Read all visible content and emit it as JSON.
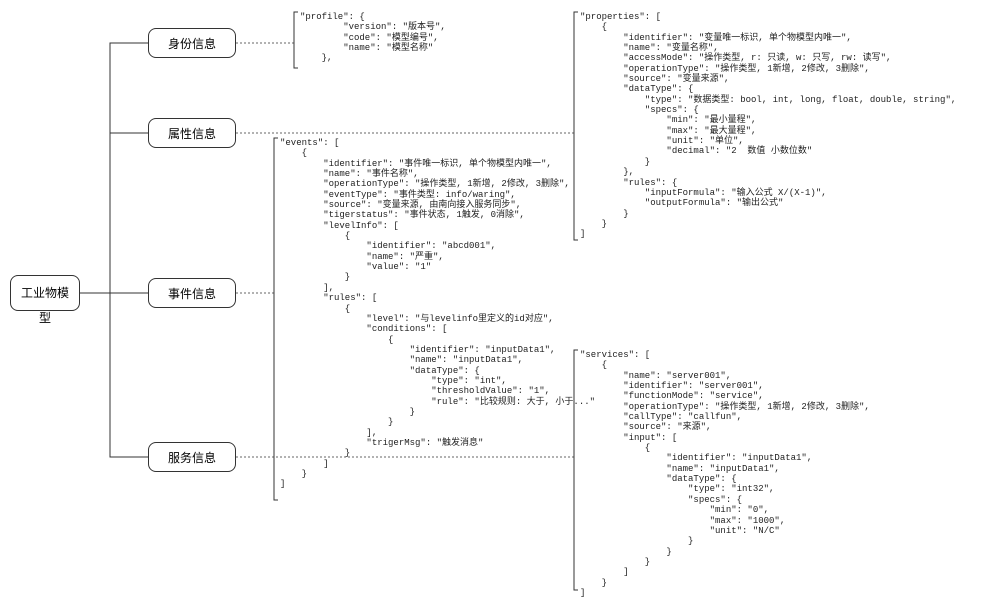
{
  "root": {
    "label": "工业物模型"
  },
  "children": [
    {
      "id": "identity",
      "label": "身份信息"
    },
    {
      "id": "property",
      "label": "属性信息"
    },
    {
      "id": "event",
      "label": "事件信息"
    },
    {
      "id": "service",
      "label": "服务信息"
    }
  ],
  "json_blocks": {
    "profile": "\"profile\": {\n        \"version\": \"版本号\",\n        \"code\": \"模型编号\",\n        \"name\": \"模型名称\"\n    },",
    "events": "\"events\": [\n    {\n        \"identifier\": \"事件唯一标识, 单个物模型内唯一\",\n        \"name\": \"事件名称\",\n        \"operationType\": \"操作类型, 1新增, 2修改, 3删除\",\n        \"eventType\": \"事件类型: info/waring\",\n        \"source\": \"变量来源, 由南向接入服务同步\",\n        \"tigerstatus\": \"事件状态, 1触发, 0消除\",\n        \"levelInfo\": [\n            {\n                \"identifier\": \"abcd001\",\n                \"name\": \"严重\",\n                \"value\": \"1\"\n            }\n        ],\n        \"rules\": [\n            {\n                \"level\": \"与levelinfo里定义的id对应\",\n                \"conditions\": [\n                    {\n                        \"identifier\": \"inputData1\",\n                        \"name\": \"inputData1\",\n                        \"dataType\": {\n                            \"type\": \"int\",\n                            \"thresholdValue\": \"1\",\n                            \"rule\": \"比较规则: 大于, 小于...\"\n                        }\n                    }\n                ],\n                \"trigerMsg\": \"触发消息\"\n            }\n        ]\n    }\n]",
    "properties": "\"properties\": [\n    {\n        \"identifier\": \"变量唯一标识, 单个物模型内唯一\",\n        \"name\": \"变量名称\",\n        \"accessMode\": \"操作类型, r: 只读, w: 只写, rw: 读写\",\n        \"operationType\": \"操作类型, 1新增, 2修改, 3删除\",\n        \"source\": \"变量来源\",\n        \"dataType\": {\n            \"type\": \"数据类型: bool, int, long, float, double, string\",\n            \"specs\": {\n                \"min\": \"最小量程\",\n                \"max\": \"最大量程\",\n                \"unit\": \"单位\",\n                \"decimal\": \"2  数值 小数位数\"\n            }\n        },\n        \"rules\": {\n            \"inputFormula\": \"输入公式 X/(X-1)\",\n            \"outputFormula\": \"输出公式\"\n        }\n    }\n]",
    "services": "\"services\": [\n    {\n        \"name\": \"server001\",\n        \"identifier\": \"server001\",\n        \"functionMode\": \"service\",\n        \"operationType\": \"操作类型, 1新增, 2修改, 3删除\",\n        \"callType\": \"callfun\",\n        \"source\": \"来源\",\n        \"input\": [\n            {\n                \"identifier\": \"inputData1\",\n                \"name\": \"inputData1\",\n                \"dataType\": {\n                    \"type\": \"int32\",\n                    \"specs\": {\n                        \"min\": \"0\",\n                        \"max\": \"1000\",\n                        \"unit\": \"N/C\"\n                    }\n                }\n            }\n        ]\n    }\n]"
  }
}
